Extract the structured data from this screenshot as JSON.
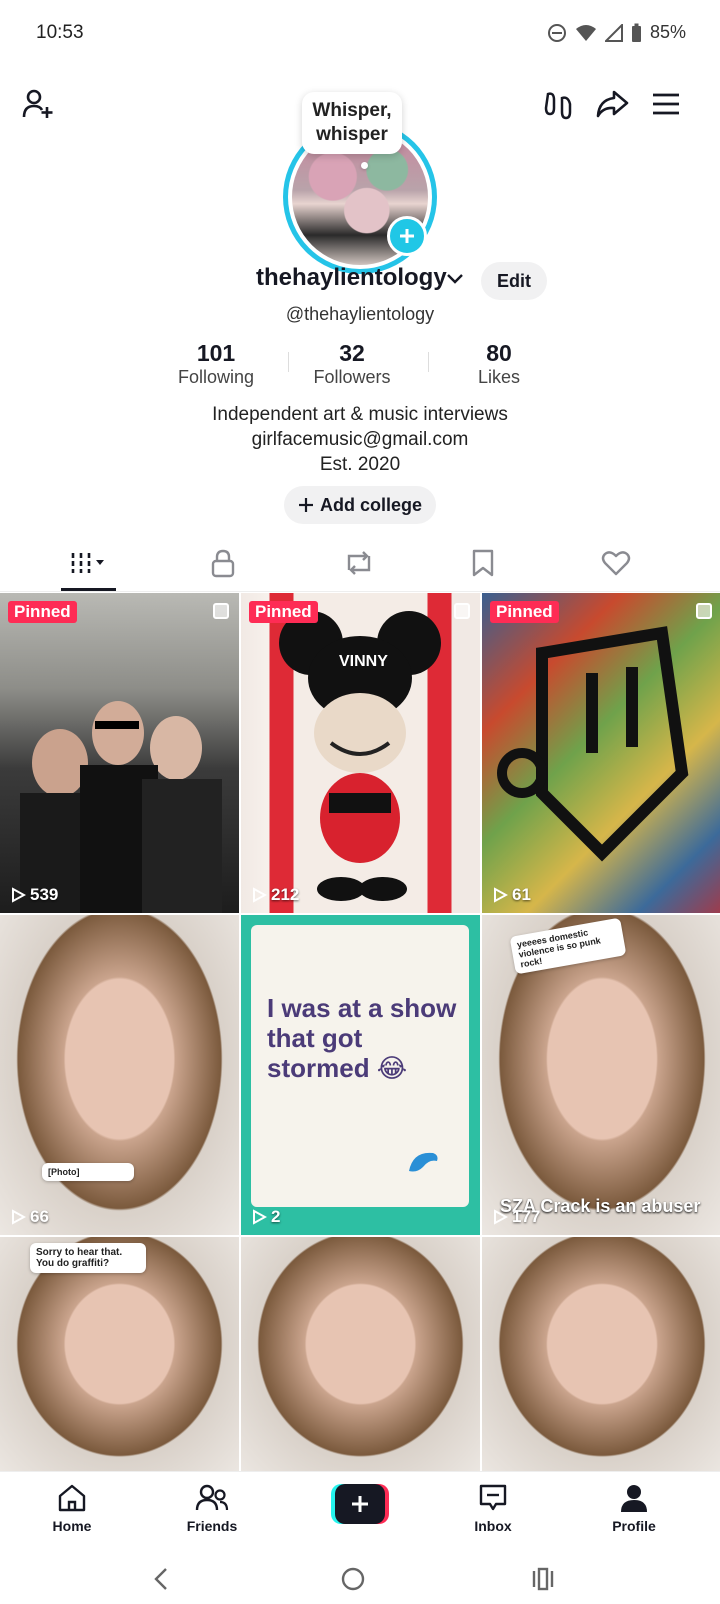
{
  "status_bar": {
    "time": "10:53",
    "battery": "85%"
  },
  "profile": {
    "username": "thehaylientology",
    "handle": "@thehaylientology",
    "edit_label": "Edit",
    "bubble_text": "Whisper, whisper",
    "stats": [
      {
        "value": "101",
        "label": "Following"
      },
      {
        "value": "32",
        "label": "Followers"
      },
      {
        "value": "80",
        "label": "Likes"
      }
    ],
    "bio": [
      "Independent art & music interviews",
      "girlfacemusic@gmail.com",
      "Est. 2020"
    ],
    "add_college_label": "Add college"
  },
  "tabs": [
    {
      "name": "videos",
      "icon": "grid-icon",
      "active": true
    },
    {
      "name": "private",
      "icon": "lock-icon"
    },
    {
      "name": "reposts",
      "icon": "repost-icon"
    },
    {
      "name": "favorites",
      "icon": "bookmark-icon"
    },
    {
      "name": "liked",
      "icon": "heart-icon"
    }
  ],
  "videos": [
    {
      "pinned": "Pinned",
      "views": "539"
    },
    {
      "pinned": "Pinned",
      "views": "212",
      "caption": "VINNY"
    },
    {
      "pinned": "Pinned",
      "views": "61"
    },
    {
      "views": "66",
      "note": "[Photo]"
    },
    {
      "views": "2",
      "caption": "I was at a show that got stormed 😂"
    },
    {
      "views": "177",
      "note": "yeeees domestic violence is so punk rock!",
      "overlay": "SZA Crack is an abuser"
    },
    {
      "note": "Sorry to hear that. You do graffiti?"
    },
    {},
    {}
  ],
  "nav": {
    "home": "Home",
    "friends": "Friends",
    "inbox": "Inbox",
    "profile": "Profile"
  },
  "colors": {
    "accent": "#fe2c55",
    "cyan": "#25f4ee",
    "avatar_ring": "#25c4e8"
  }
}
